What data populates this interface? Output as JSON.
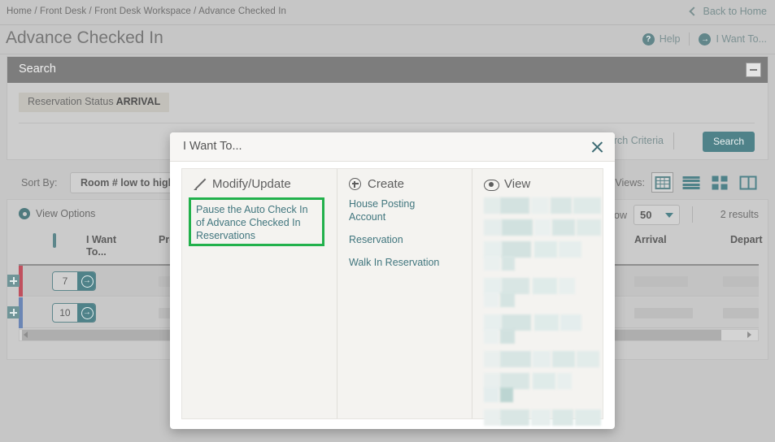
{
  "breadcrumb": "Home / Front Desk / Front Desk Workspace / Advance Checked In",
  "back_to_home": "Back to Home",
  "page_title": "Advance Checked In",
  "title_actions": {
    "help": "Help",
    "i_want_to": "I Want To..."
  },
  "search_panel": {
    "heading": "Search",
    "chip_label": "Reservation Status",
    "chip_value": "ARRIVAL",
    "modify_criteria": "Modify Search Criteria",
    "search_button": "Search"
  },
  "sort_row": {
    "sort_by_label": "Sort By:",
    "sort_by_value": "Room # low to high",
    "views_label": "Views:",
    "view_modes": [
      "grid-view",
      "list-view",
      "tile-view",
      "split-view"
    ]
  },
  "results": {
    "view_options": "View Options",
    "show_label": "Show",
    "show_value": "50",
    "result_count": "2 results",
    "columns": [
      "I Want To...",
      "Prope",
      "Arrival",
      "Depart"
    ],
    "rows": [
      {
        "action_number": "7",
        "indicator_color": "#c0505e"
      },
      {
        "action_number": "10",
        "indicator_color": "#6b86b5"
      }
    ]
  },
  "modal": {
    "title": "I Want To...",
    "columns": [
      {
        "heading": "Modify/Update",
        "icon": "pencil-icon",
        "links": [
          "Pause the Auto Check In of Advance Checked In Reservations"
        ],
        "highlighted": true,
        "highlight_color": "#22b14c"
      },
      {
        "heading": "Create",
        "icon": "plus-circle-icon",
        "links": [
          "House Posting Account",
          "Reservation",
          "Walk In Reservation"
        ],
        "highlighted": false
      },
      {
        "heading": "View",
        "icon": "eye-icon",
        "links": [],
        "highlighted": false
      }
    ]
  },
  "colors": {
    "accent_teal": "#4f8289",
    "link_teal": "#41767e",
    "page_bg": "#c6c6c6",
    "panel_header": "#7d7d7d",
    "highlight_green": "#22b14c"
  }
}
